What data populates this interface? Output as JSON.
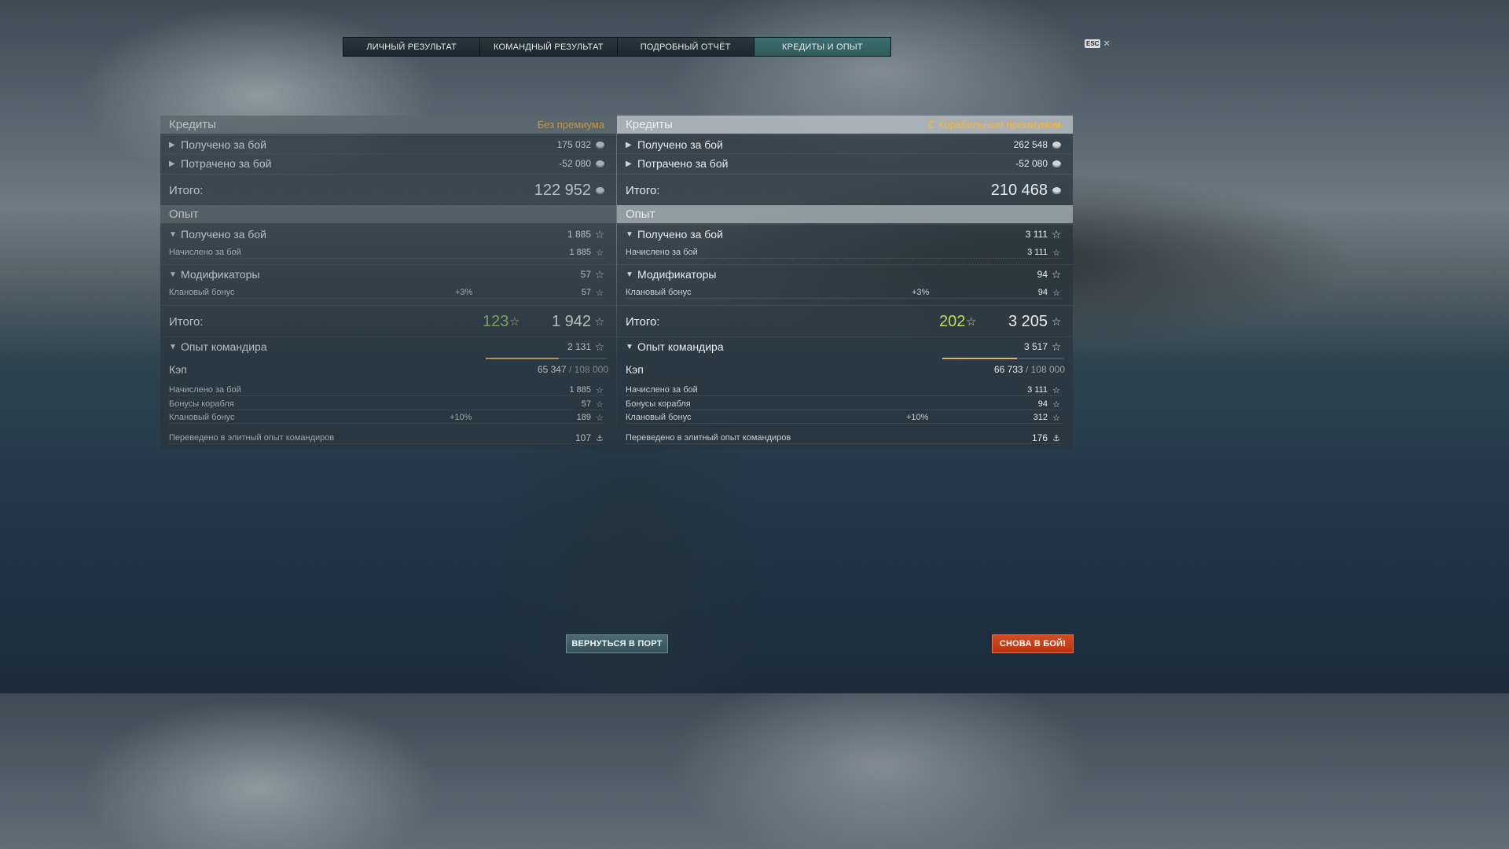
{
  "tabs": [
    "ЛИЧНЫЙ РЕЗУЛЬТАТ",
    "КОМАНДНЫЙ РЕЗУЛЬТАТ",
    "ПОДРОБНЫЙ ОТЧЁТ",
    "КРЕДИТЫ И ОПЫТ"
  ],
  "active_tab": "КРЕДИТЫ И ОПЫТ",
  "esc_label": "ESC",
  "left": {
    "credits_title": "Кредиты",
    "badge": "Без премиума",
    "received_label": "Получено за бой",
    "received_value": "175 032",
    "spent_label": "Потрачено за бой",
    "spent_value": "-52 080",
    "total_label": "Итого:",
    "credits_total": "122 952",
    "exp_title": "Опыт",
    "exp_received_label": "Получено за бой",
    "exp_received_value": "1 885",
    "accrued_label": "Начислено за бой",
    "accrued_value": "1 885",
    "mods_label": "Модификаторы",
    "mods_value": "57",
    "clan_label": "Клановый бонус",
    "clan_pct": "+3%",
    "clan_value": "57",
    "exp_total_label": "Итого:",
    "exp_bonus": "123",
    "exp_total": "1 942",
    "cmdr_label": "Опыт командира",
    "cmdr_value": "2 131",
    "cap_label": "Кэп",
    "cap_value": "65 347",
    "cap_max": "/ 108 000",
    "cap_fraction": 0.605,
    "c_accrued_label": "Начислено за бой",
    "c_accrued_value": "1 885",
    "c_ship_label": "Бонусы корабля",
    "c_ship_value": "57",
    "c_clan_label": "Клановый бонус",
    "c_clan_pct": "+10%",
    "c_clan_value": "189",
    "elite_label": "Переведено в элитный опыт командиров",
    "elite_value": "107"
  },
  "right": {
    "credits_title": "Кредиты",
    "badge": "С Корабельным премиумом",
    "received_label": "Получено за бой",
    "received_value": "262 548",
    "spent_label": "Потрачено за бой",
    "spent_value": "-52 080",
    "total_label": "Итого:",
    "credits_total": "210 468",
    "exp_title": "Опыт",
    "exp_received_label": "Получено за бой",
    "exp_received_value": "3 111",
    "accrued_label": "Начислено за бой",
    "accrued_value": "3 111",
    "mods_label": "Модификаторы",
    "mods_value": "94",
    "clan_label": "Клановый бонус",
    "clan_pct": "+3%",
    "clan_value": "94",
    "exp_total_label": "Итого:",
    "exp_bonus": "202",
    "exp_total": "3 205",
    "cmdr_label": "Опыт командира",
    "cmdr_value": "3 517",
    "cap_label": "Кэп",
    "cap_value": "66 733",
    "cap_max": "/ 108 000",
    "cap_fraction": 0.618,
    "c_accrued_label": "Начислено за бой",
    "c_accrued_value": "3 111",
    "c_ship_label": "Бонусы корабля",
    "c_ship_value": "94",
    "c_clan_label": "Клановый бонус",
    "c_clan_pct": "+10%",
    "c_clan_value": "312",
    "elite_label": "Переведено в элитный опыт командиров",
    "elite_value": "176"
  },
  "buttons": {
    "port": "ВЕРНУТЬСЯ В ПОРТ",
    "battle": "СНОВА В БОЙ!"
  },
  "colors": {
    "badge": "#f5b640",
    "active_tab": "#3d6e70",
    "battle_button": "#c8401a",
    "bonus_xp": "#b8e04a"
  }
}
